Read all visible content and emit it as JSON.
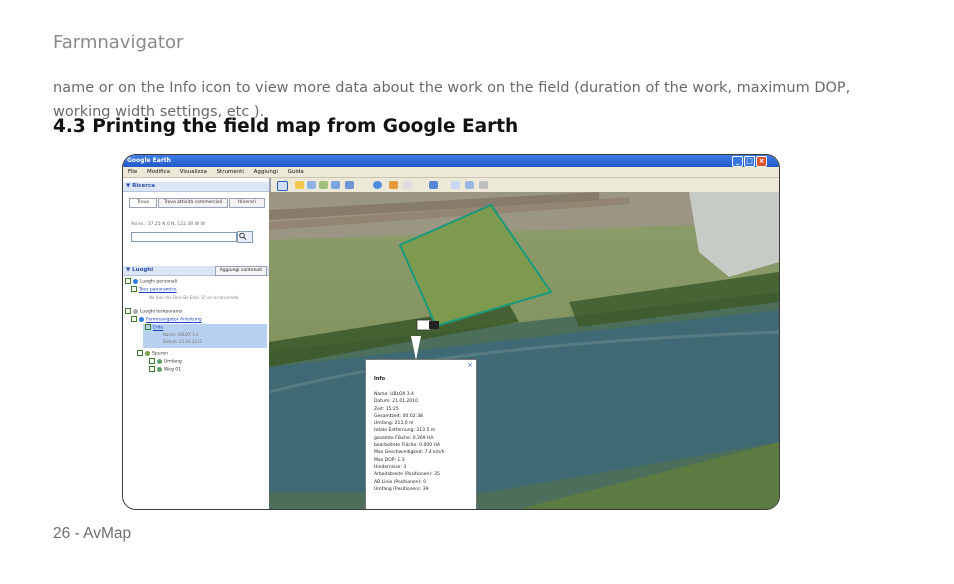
{
  "header": {
    "title": "Farmnavigator"
  },
  "body": {
    "paragraph": "name or on the Info icon to view more data about the work on the field (duration of the work, maximum DOP, working width settings, etc ).",
    "section_heading": "4.3 Printing the field map from Google Earth"
  },
  "screenshot": {
    "window_title": "Google Earth",
    "menu": [
      "File",
      "Modifica",
      "Visualizza",
      "Strumenti",
      "Aggiungi",
      "Guida"
    ],
    "search_panel": {
      "title": "▼ Ricerca",
      "tabs": [
        "Trova",
        "Trova attività commerciali",
        "Itinerari"
      ],
      "hint": "Ad es.: 37.25 N 0 N, 122.38 W W"
    },
    "places_panel": {
      "title": "▼ Luoghi",
      "add_button": "Aggiungi contenuti",
      "items": [
        "Luoghi personali",
        "Tour panoramico",
        "Ne fuoi che Devi Bo Edici 'D' sin arranceredo",
        "Luoghi temporanei",
        "Farmnavigator Anleitung",
        "Erde",
        "Name: UBLOX 3.4",
        "Datum: 21.01.2012",
        "Spuren",
        "Umfang",
        "Weg 01"
      ]
    },
    "popup": {
      "heading": "Info",
      "close_icon": "×",
      "lines": [
        "Name: UBLOX 3.4",
        "Datum: 21.01.2010",
        "Zeit: 15:25",
        "Gesamtzeit: 00:02:38",
        "Umfang: 213.0 m",
        "totale Entfernung: 213.5 m",
        "gesamte Fläche: 0.269 HA",
        "bearbeitete Fläche: 0.000 HA",
        "Max Geschwindigkeit: 7.4 km/h",
        "Max DOP: 1.3",
        "Hindernisse: 3",
        "Arbeitsbreite (Positionen): 35",
        "AB Linie (Positionen): 0",
        "Umfang (Positionen): 39"
      ]
    }
  },
  "footer": {
    "page": "26 - AvMap"
  }
}
